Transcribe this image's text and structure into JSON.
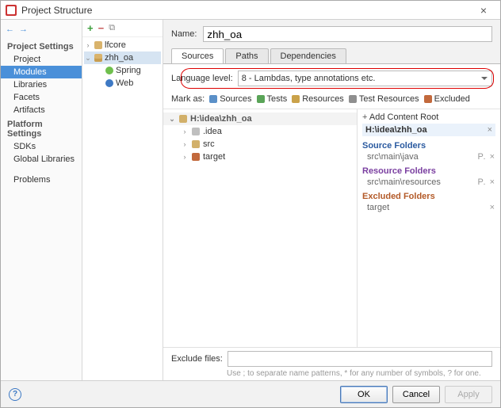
{
  "window": {
    "title": "Project Structure"
  },
  "icons": {
    "close": "×",
    "plus": "+",
    "minus": "−",
    "copy": "⧉",
    "arrow_left": "←",
    "arrow_right": "→"
  },
  "sidebar": {
    "section1": "Project Settings",
    "items1": [
      "Project",
      "Modules",
      "Libraries",
      "Facets",
      "Artifacts"
    ],
    "selected1_index": 1,
    "section2": "Platform Settings",
    "items2": [
      "SDKs",
      "Global Libraries"
    ],
    "section3": "",
    "items3": [
      "Problems"
    ]
  },
  "modules_tree": {
    "items": [
      {
        "arrow": "›",
        "icon": "dir",
        "label": "lfcore"
      },
      {
        "arrow": "⌄",
        "icon": "dir-o",
        "label": "zhh_oa",
        "selected": true
      },
      {
        "arrow": "",
        "icon": "spring",
        "label": "Spring",
        "indent": 1
      },
      {
        "arrow": "",
        "icon": "web",
        "label": "Web",
        "indent": 1
      }
    ]
  },
  "name_field": {
    "label": "Name:",
    "value": "zhh_oa"
  },
  "tabs": {
    "items": [
      "Sources",
      "Paths",
      "Dependencies"
    ],
    "active": 0
  },
  "language": {
    "label": "Language level:",
    "value": "8 - Lambdas, type annotations etc."
  },
  "mark": {
    "label": "Mark as:",
    "items": [
      {
        "label": "Sources",
        "cls": "c-src"
      },
      {
        "label": "Tests",
        "cls": "c-tst"
      },
      {
        "label": "Resources",
        "cls": "c-res"
      },
      {
        "label": "Test Resources",
        "cls": "c-tres"
      },
      {
        "label": "Excluded",
        "cls": "c-exc"
      }
    ]
  },
  "src_tree": {
    "root": "H:\\idea\\zhh_oa",
    "children": [
      {
        "label": ".idea",
        "icon": "ic-fold-g"
      },
      {
        "label": "src",
        "icon": "ic-fold"
      },
      {
        "label": "target",
        "icon": "ic-fold-o"
      }
    ]
  },
  "right": {
    "add": "Add Content Root",
    "content_root": "H:\\idea\\zhh_oa",
    "groups": [
      {
        "title": "Source Folders",
        "cls": "rp-blue",
        "items": [
          {
            "path": "src\\main\\java",
            "actions": "P. ×"
          }
        ]
      },
      {
        "title": "Resource Folders",
        "cls": "rp-purple",
        "items": [
          {
            "path": "src\\main\\resources",
            "actions": "P. ×"
          }
        ]
      },
      {
        "title": "Excluded Folders",
        "cls": "rp-orange",
        "items": [
          {
            "path": "target",
            "actions": "×"
          }
        ]
      }
    ]
  },
  "exclude": {
    "label": "Exclude files:",
    "value": "",
    "hint": "Use ; to separate name patterns, * for any number of symbols, ? for one."
  },
  "buttons": {
    "ok": "OK",
    "cancel": "Cancel",
    "apply": "Apply"
  }
}
